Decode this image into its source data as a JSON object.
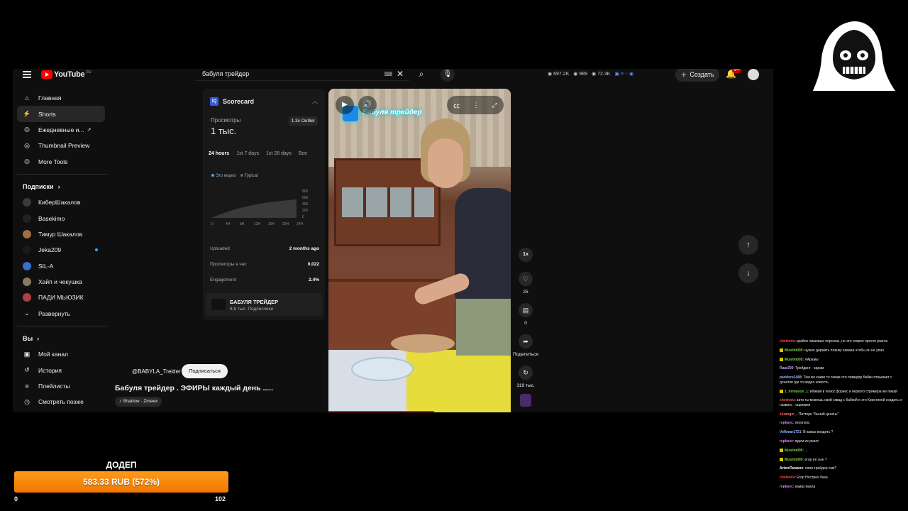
{
  "header": {
    "logo_text": "YouTube",
    "region": "RU",
    "search_value": "бабуля трейдер",
    "stat1": "697.2K",
    "stat2": "989",
    "stat3": "72.3K",
    "create_label": "Создать",
    "bell_badge": "9+"
  },
  "sidebar": {
    "main": [
      {
        "label": "Главная",
        "icon": "home-icon"
      },
      {
        "label": "Shorts",
        "icon": "shorts-icon"
      },
      {
        "label": "Ежедневные и...",
        "icon": "daily-icon"
      },
      {
        "label": "Thumbnail Preview",
        "icon": "thumbnail-icon"
      },
      {
        "label": "More Tools",
        "icon": "tools-icon"
      }
    ],
    "subs_heading": "Подписки",
    "subs": [
      {
        "label": "КиберШакалов",
        "color": "#3a3a3a"
      },
      {
        "label": "Basekimo",
        "color": "#222222"
      },
      {
        "label": "Тимур Шакалов",
        "color": "#a07040"
      },
      {
        "label": "Jeka209",
        "color": "#1a1a1a"
      },
      {
        "label": "SIL-A",
        "color": "#3b6ec8"
      },
      {
        "label": "Хайп и чекушка",
        "color": "#8a7a5a"
      },
      {
        "label": "ПАДИ МЬЮЗИК",
        "color": "#b04040"
      }
    ],
    "expand_label": "Развернуть",
    "you_heading": "Вы",
    "you": [
      {
        "label": "Мой канал",
        "icon": "channel-icon"
      },
      {
        "label": "История",
        "icon": "history-icon"
      },
      {
        "label": "Плейлисты",
        "icon": "playlist-icon"
      },
      {
        "label": "Смотреть позже",
        "icon": "clock-icon"
      }
    ]
  },
  "scorecard": {
    "title": "Scorecard",
    "views_label": "Просмотры",
    "views_value": "1 тыс.",
    "outlier": "1.3x Outlier",
    "periods": [
      "24 hours",
      "1st 7 days",
      "1st 28 days",
      "Все"
    ],
    "legend_this": "Это видео",
    "legend_typical": "Typical",
    "y_ticks": [
      "800",
      "600",
      "400",
      "200",
      "0"
    ],
    "x_ticks": [
      "0",
      "4H",
      "8H",
      "12H",
      "16H",
      "20H",
      "24H"
    ],
    "uploaded_label": "Uploaded",
    "uploaded_value": "2 months ago",
    "vph_label": "Просмотры в час",
    "vph_value": "0,022",
    "engagement_label": "Engagement",
    "engagement_value": "2.4%",
    "channel_name": "БАБУЛЯ ТРЕЙДЕР",
    "channel_subs": "8,8 тыс. Подписчики"
  },
  "video": {
    "overlay_title": "Бабуля трейдер",
    "handle": "@BABYLA_Treider",
    "subscribe": "Подписаться",
    "title": "Бабуля трейдер . ЭФИРЫ каждый день .....",
    "music": "Shadow · Zmeex",
    "progress": 0.58
  },
  "actions": {
    "speed": "1x",
    "likes": "25",
    "comments": "0",
    "share": "Поделиться",
    "remix": "319 тыс."
  },
  "donation": {
    "label": "ДОДЕП",
    "amount": "583.33 RUB (572%)",
    "min": "0",
    "max": "102"
  },
  "chat": [
    {
      "user": "chertodu",
      "color": "#ff4d4d",
      "text": "крайне нишевые персоны, но это скорее просто разгон",
      "badge": false
    },
    {
      "user": "Muslim005",
      "color": "#7bd24a",
      "text": "нужно держать планку камаза чтобы он не упал",
      "badge": true
    },
    {
      "user": "Muslim005",
      "color": "#7bd24a",
      "text": "ХАрамы",
      "badge": true
    },
    {
      "user": "Raar200",
      "color": "#c8a0ff",
      "text": "Трейдинг - харам",
      "badge": false
    },
    {
      "user": "pandora1488",
      "color": "#8fb8ff",
      "text": "Тем же какие то темки что помидор бабки отмывает с донатов где то видел новость",
      "badge": false
    },
    {
      "user": "1_mimaxon_1",
      "color": "#7bd24a",
      "text": "вбивай в поиск форекс и первого стримера же пикай",
      "badge": true
    },
    {
      "user": "chertodu",
      "color": "#ff4d4d",
      "text": "зато ты можешь свой сквад с бабкой и это Кристиной создать и назвать - ощимики",
      "badge": false
    },
    {
      "user": "s1ranger_",
      "color": "#ff6b6b",
      "text": "Паттерн \"бычий ценень\"",
      "badge": false
    },
    {
      "user": "repkavc",
      "color": "#d080ff",
      "text": "пхпхпхпх",
      "badge": false
    },
    {
      "user": "Volkmar1721",
      "color": "#8fb8ff",
      "text": "В камаз входить ?",
      "badge": false
    },
    {
      "user": "repkavc",
      "color": "#d080ff",
      "text": "ждем их реакт",
      "badge": false
    },
    {
      "user": "Muslim005",
      "color": "#7bd24a",
      "text": "...",
      "badge": true
    },
    {
      "user": "Muslim005",
      "color": "#7bd24a",
      "text": "егор ее сын ?",
      "badge": true
    },
    {
      "user": "ArtemTarasov",
      "color": "#ffffff",
      "text": "папа трейдер там?",
      "badge": false
    },
    {
      "user": "chertodu",
      "color": "#ff4d4d",
      "text": "Егор Нострео база",
      "badge": false
    },
    {
      "user": "repkavc",
      "color": "#d080ff",
      "text": "камаз екала",
      "badge": false
    }
  ],
  "colors": {
    "accent": "#ff0000",
    "donate_orange": "#f58a07",
    "progress_red": "#ff0033"
  }
}
